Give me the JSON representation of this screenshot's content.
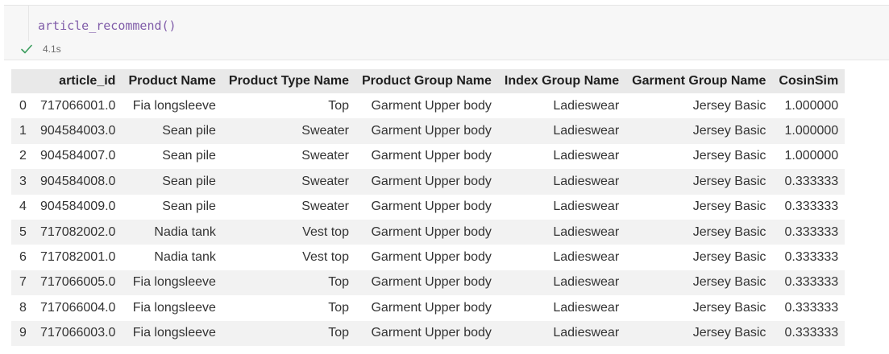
{
  "cell": {
    "code": "article_recommend()",
    "exec_time": "4.1s",
    "status_icon": "check-icon",
    "accent": "#7f5ba8",
    "success_color": "#3a9d5d"
  },
  "table": {
    "columns": [
      "",
      "article_id",
      "Product Name",
      "Product Type Name",
      "Product Group Name",
      "Index Group Name",
      "Garment Group Name",
      "CosinSim"
    ],
    "rows": [
      [
        "0",
        "717066001.0",
        "Fia longsleeve",
        "Top",
        "Garment Upper body",
        "Ladieswear",
        "Jersey Basic",
        "1.000000"
      ],
      [
        "1",
        "904584003.0",
        "Sean pile",
        "Sweater",
        "Garment Upper body",
        "Ladieswear",
        "Jersey Basic",
        "1.000000"
      ],
      [
        "2",
        "904584007.0",
        "Sean pile",
        "Sweater",
        "Garment Upper body",
        "Ladieswear",
        "Jersey Basic",
        "1.000000"
      ],
      [
        "3",
        "904584008.0",
        "Sean pile",
        "Sweater",
        "Garment Upper body",
        "Ladieswear",
        "Jersey Basic",
        "0.333333"
      ],
      [
        "4",
        "904584009.0",
        "Sean pile",
        "Sweater",
        "Garment Upper body",
        "Ladieswear",
        "Jersey Basic",
        "0.333333"
      ],
      [
        "5",
        "717082002.0",
        "Nadia tank",
        "Vest top",
        "Garment Upper body",
        "Ladieswear",
        "Jersey Basic",
        "0.333333"
      ],
      [
        "6",
        "717082001.0",
        "Nadia tank",
        "Vest top",
        "Garment Upper body",
        "Ladieswear",
        "Jersey Basic",
        "0.333333"
      ],
      [
        "7",
        "717066005.0",
        "Fia longsleeve",
        "Top",
        "Garment Upper body",
        "Ladieswear",
        "Jersey Basic",
        "0.333333"
      ],
      [
        "8",
        "717066004.0",
        "Fia longsleeve",
        "Top",
        "Garment Upper body",
        "Ladieswear",
        "Jersey Basic",
        "0.333333"
      ],
      [
        "9",
        "717066003.0",
        "Fia longsleeve",
        "Top",
        "Garment Upper body",
        "Ladieswear",
        "Jersey Basic",
        "0.333333"
      ]
    ]
  }
}
